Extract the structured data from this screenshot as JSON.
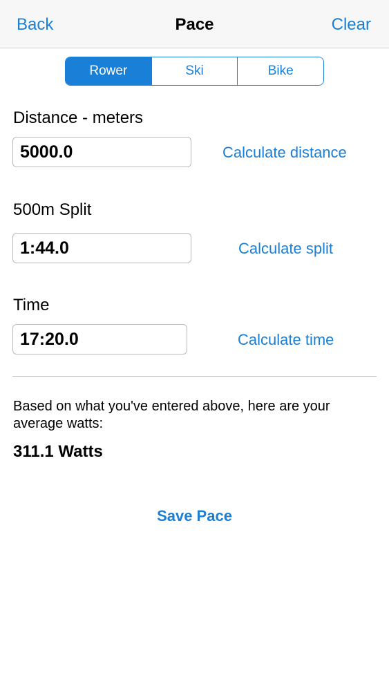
{
  "navbar": {
    "back_label": "Back",
    "title": "Pace",
    "clear_label": "Clear"
  },
  "segments": [
    {
      "label": "Rower",
      "selected": true
    },
    {
      "label": "Ski",
      "selected": false
    },
    {
      "label": "Bike",
      "selected": false
    }
  ],
  "distance": {
    "label": "Distance - meters",
    "value": "5000.0",
    "action": "Calculate distance"
  },
  "split": {
    "label": "500m Split",
    "value": "1:44.0",
    "action": "Calculate split"
  },
  "time": {
    "label": "Time",
    "value": "17:20.0",
    "action": "Calculate time"
  },
  "result": {
    "description": "Based on what you've entered above, here are your average watts:",
    "watts": "311.1 Watts"
  },
  "save_label": "Save Pace",
  "colors": {
    "accent": "#1a7fd6",
    "navbar_bg": "#f7f7f7"
  }
}
